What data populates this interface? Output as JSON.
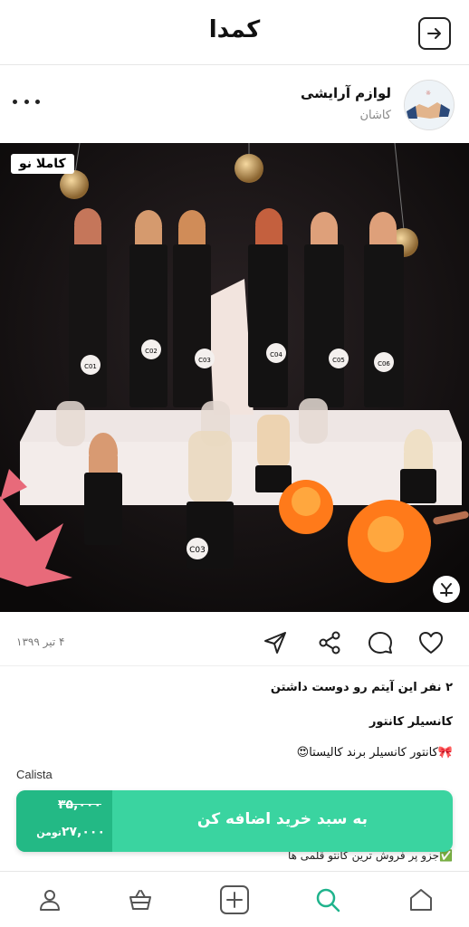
{
  "header": {
    "app_title": "کمدا",
    "back_icon": "arrow-right-icon"
  },
  "post": {
    "shop_name": "لوازم آرایشی",
    "shop_city": "کاشان",
    "badge": "کاملا نو",
    "date": "۴ تیر ۱۳۹۹",
    "likes_text": "۲ نفر این آیتم رو دوست داشتن",
    "title": "کانسیلر کانتور",
    "description": "🎀کانتور کانسیلر برند کالیستا😍",
    "description_line2": "✅جزو پر فروش ترین کانتو قلمی ها",
    "brand": "Calista"
  },
  "product_image": {
    "stick_labels": [
      "C01",
      "C02",
      "C03",
      "C04",
      "C05",
      "C06"
    ],
    "front_label": "C03"
  },
  "cart": {
    "label": "به سبد خرید اضافه کن",
    "old_price": "۳۵,۰۰۰",
    "new_price": "۲۷,۰۰۰",
    "currency": "تومن"
  },
  "nav": {
    "items": [
      "home-icon",
      "search-icon",
      "add-icon",
      "basket-icon",
      "profile-icon"
    ],
    "active": "search-icon"
  },
  "colors": {
    "accent": "#3ad4a0",
    "accent_dark": "#23b985",
    "active_nav": "#1fb38c"
  }
}
